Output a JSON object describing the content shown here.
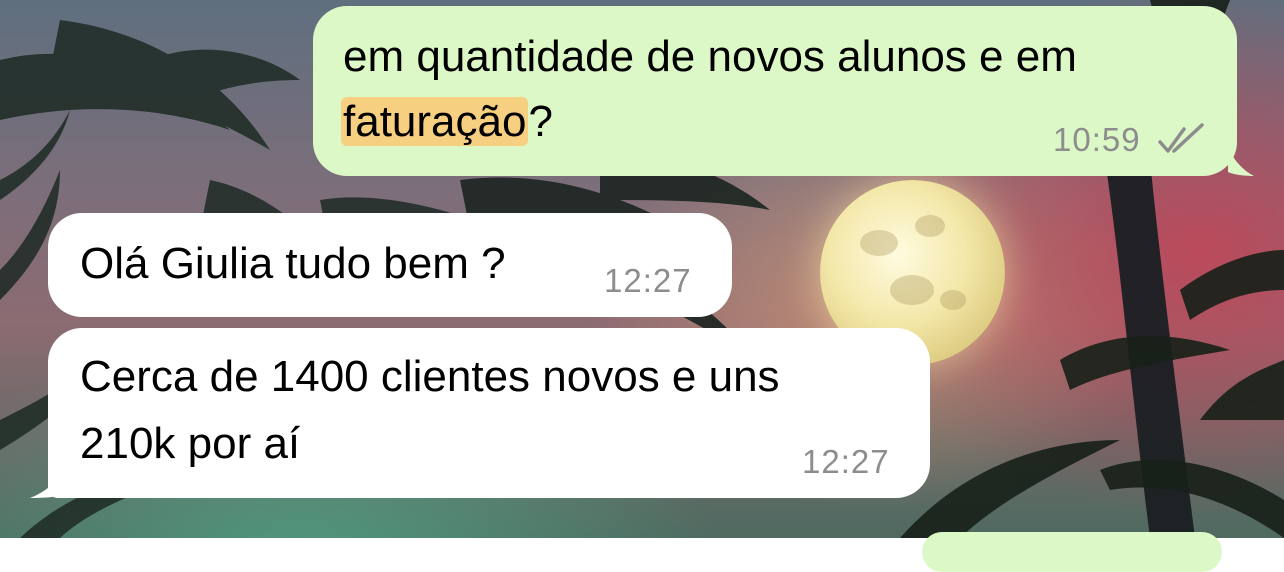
{
  "messages": [
    {
      "direction": "outgoing",
      "line1": "em quantidade de novos alunos e em",
      "line2_highlight": "faturação",
      "line2_rest": "?",
      "time": "10:59",
      "status": "read",
      "status_icon": "double-check-icon",
      "highlight_color": "#f7cf80"
    },
    {
      "direction": "incoming",
      "text": "Olá Giulia tudo bem ?",
      "time": "12:27"
    },
    {
      "direction": "incoming",
      "line1": "Cerca de 1400 clientes novos e uns",
      "line2": "210k por aí",
      "time": "12:27"
    }
  ],
  "colors": {
    "outgoing_bubble": "#dcf8c6",
    "incoming_bubble": "#ffffff",
    "timestamp": "#8d8d8d"
  },
  "wallpaper": {
    "scene": "palm trees and full moon at dusk"
  }
}
